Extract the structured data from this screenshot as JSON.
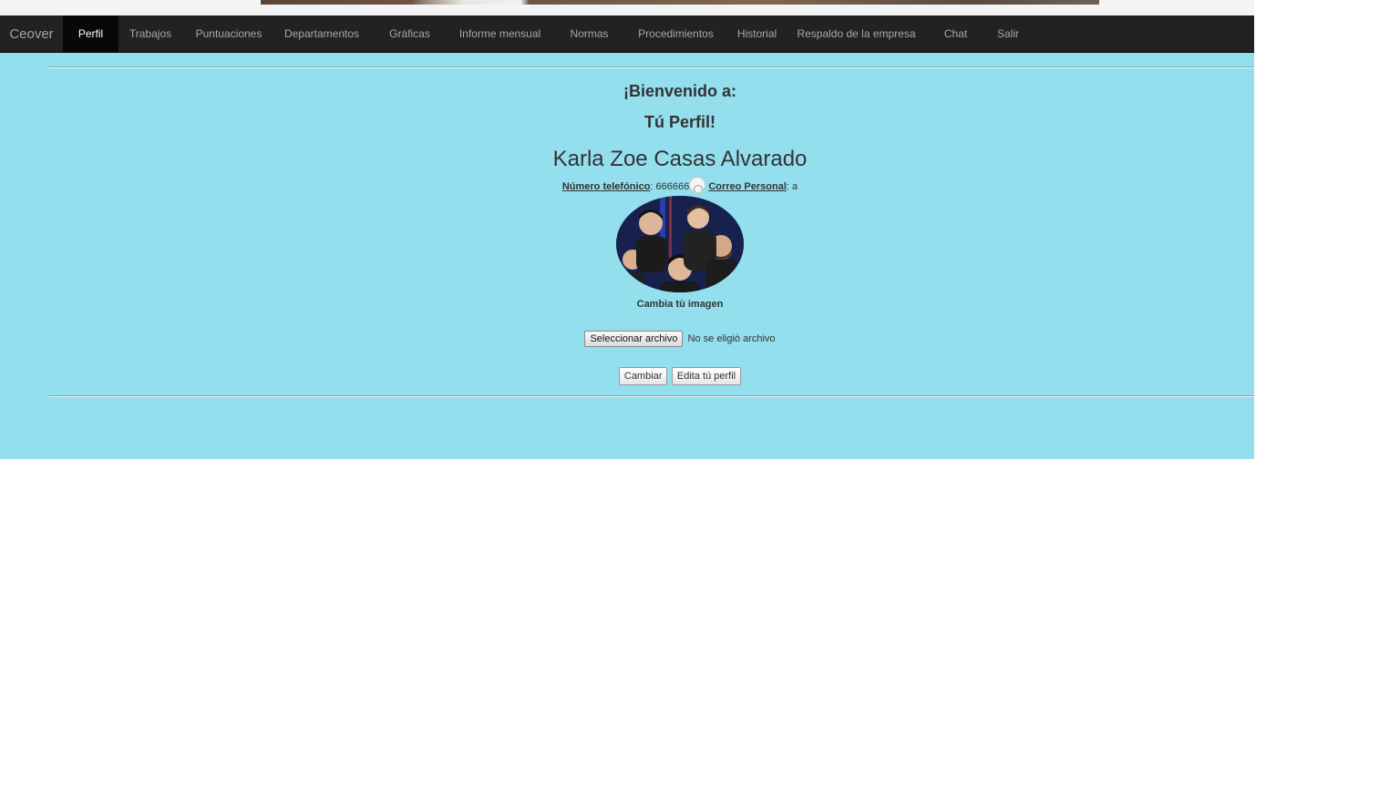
{
  "navbar": {
    "brand": "Ceover",
    "items": [
      {
        "label": "Perfil"
      },
      {
        "label": "Trabajos"
      },
      {
        "label": "Puntuaciones"
      },
      {
        "label": "Departamentos"
      },
      {
        "label": "Gráficas"
      },
      {
        "label": "Informe mensual"
      },
      {
        "label": "Normas"
      },
      {
        "label": "Procedimientos"
      },
      {
        "label": "Historial"
      },
      {
        "label": "Respaldo de la empresa"
      },
      {
        "label": "Chat"
      },
      {
        "label": "Salir"
      }
    ],
    "active": "Perfil"
  },
  "profile": {
    "welcome_line1": "¡Bienvenido a:",
    "welcome_line2": "Tú Perfil!",
    "name": "Karla Zoe Casas Alvarado",
    "phone_label": "Número telefónico",
    "phone_value": ": 666666",
    "email_label": "Correo Personal",
    "email_value": ": a",
    "change_image_label": "Cambia tù imagen"
  },
  "upload": {
    "button_label": "Seleccionar archivo",
    "status_text": "No se eligió archivo"
  },
  "actions": {
    "change_label": "Cambiar",
    "edit_label": "Edita tú perfil"
  },
  "colors": {
    "page_background": "#93dfed",
    "navbar_background": "#222222",
    "active_nav_background": "#080808"
  }
}
